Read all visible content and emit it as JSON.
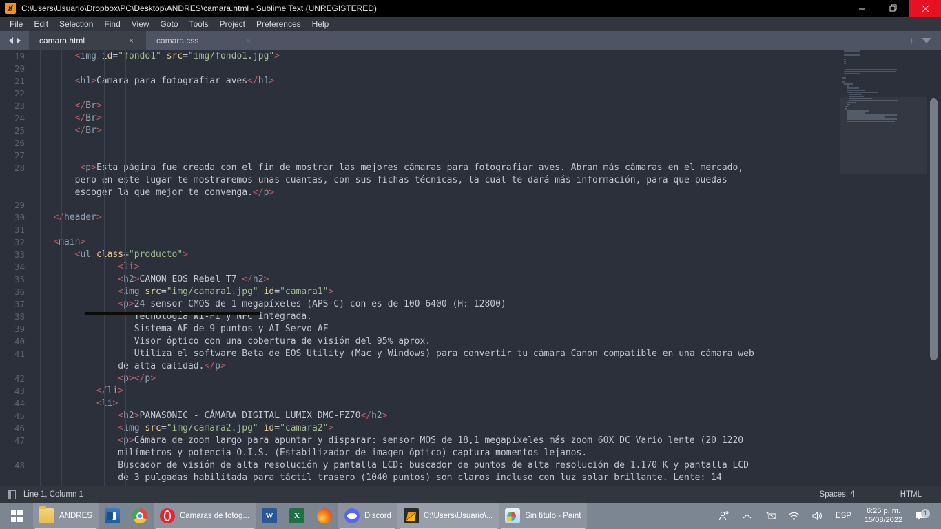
{
  "window": {
    "title": "C:\\Users\\Usuario\\Dropbox\\PC\\Desktop\\ANDRES\\camara.html - Sublime Text (UNREGISTERED)",
    "app_icon": "sublime-text-icon",
    "controls": {
      "minimize": "minimize-icon",
      "maximize": "maximize-icon",
      "close": "close-icon"
    },
    "accent_close": "#e81123"
  },
  "menubar": {
    "items": [
      {
        "label": "File"
      },
      {
        "label": "Edit"
      },
      {
        "label": "Selection"
      },
      {
        "label": "Find"
      },
      {
        "label": "View"
      },
      {
        "label": "Goto"
      },
      {
        "label": "Tools"
      },
      {
        "label": "Project"
      },
      {
        "label": "Preferences"
      },
      {
        "label": "Help"
      }
    ]
  },
  "tabbar": {
    "prev_icon": "arrow-left-icon",
    "next_icon": "arrow-right-icon",
    "tabs": [
      {
        "label": "camara.html",
        "active": true,
        "close": "×"
      },
      {
        "label": "camara.css",
        "active": false,
        "close": "×"
      }
    ],
    "new_tab": "+",
    "tab_menu": "chevron-down-icon"
  },
  "editor": {
    "first_line": 19,
    "lines": [
      {
        "n": 19,
        "tokens": [
          {
            "t": "sp",
            "v": "        "
          },
          {
            "t": "tagp",
            "v": "<"
          },
          {
            "t": "tagn",
            "v": "img "
          },
          {
            "t": "attr",
            "v": "id"
          },
          {
            "t": "eq",
            "v": "="
          },
          {
            "t": "str",
            "v": "\"fondo1\""
          },
          {
            "t": "txt",
            "v": " "
          },
          {
            "t": "attr",
            "v": "src"
          },
          {
            "t": "eq",
            "v": "="
          },
          {
            "t": "str",
            "v": "\"img/fondo1.jpg\""
          },
          {
            "t": "tagp",
            "v": ">"
          }
        ]
      },
      {
        "n": 20,
        "tokens": []
      },
      {
        "n": 21,
        "tokens": [
          {
            "t": "sp",
            "v": "        "
          },
          {
            "t": "tagp",
            "v": "<"
          },
          {
            "t": "tagn",
            "v": "h1"
          },
          {
            "t": "tagp",
            "v": ">"
          },
          {
            "t": "txt",
            "v": "Camara para fotografiar aves"
          },
          {
            "t": "tagp",
            "v": "</"
          },
          {
            "t": "tagn",
            "v": "h1"
          },
          {
            "t": "tagp",
            "v": ">"
          }
        ]
      },
      {
        "n": 22,
        "tokens": []
      },
      {
        "n": 23,
        "tokens": [
          {
            "t": "sp",
            "v": "        "
          },
          {
            "t": "tagp",
            "v": "</"
          },
          {
            "t": "tagn",
            "v": "Br"
          },
          {
            "t": "tagp",
            "v": ">"
          }
        ]
      },
      {
        "n": 24,
        "tokens": [
          {
            "t": "sp",
            "v": "        "
          },
          {
            "t": "tagp",
            "v": "</"
          },
          {
            "t": "tagn",
            "v": "Br"
          },
          {
            "t": "tagp",
            "v": ">"
          }
        ]
      },
      {
        "n": 25,
        "tokens": [
          {
            "t": "sp",
            "v": "        "
          },
          {
            "t": "tagp",
            "v": "</"
          },
          {
            "t": "tagn",
            "v": "Br"
          },
          {
            "t": "tagp",
            "v": ">"
          }
        ]
      },
      {
        "n": 26,
        "tokens": []
      },
      {
        "n": 27,
        "tokens": []
      },
      {
        "n": 28,
        "tokens": [
          {
            "t": "sp",
            "v": "         "
          },
          {
            "t": "tagp",
            "v": "<"
          },
          {
            "t": "tagn",
            "v": "p"
          },
          {
            "t": "tagp",
            "v": ">"
          },
          {
            "t": "txt",
            "v": "Esta página fue creada con el fin de mostrar las mejores cámaras para fotografiar aves. Abran más cámaras en el mercado,"
          }
        ]
      },
      {
        "n": "",
        "tokens": [
          {
            "t": "sp",
            "v": "        "
          },
          {
            "t": "txt",
            "v": "pero en este lugar te mostraremos unas cuantas, con sus fichas técnicas, la cual te dará más información, para que puedas"
          }
        ]
      },
      {
        "n": "",
        "tokens": [
          {
            "t": "sp",
            "v": "        "
          },
          {
            "t": "txt",
            "v": "escoger la que mejor te convenga."
          },
          {
            "t": "tagp",
            "v": "</"
          },
          {
            "t": "tagn",
            "v": "p"
          },
          {
            "t": "tagp",
            "v": ">"
          }
        ]
      },
      {
        "n": 29,
        "tokens": []
      },
      {
        "n": 30,
        "tokens": [
          {
            "t": "sp",
            "v": "    "
          },
          {
            "t": "tagp",
            "v": "</"
          },
          {
            "t": "tagn",
            "v": "header"
          },
          {
            "t": "tagp",
            "v": ">"
          }
        ]
      },
      {
        "n": 31,
        "tokens": []
      },
      {
        "n": 32,
        "tokens": [
          {
            "t": "sp",
            "v": "    "
          },
          {
            "t": "tagp",
            "v": "<"
          },
          {
            "t": "tagn",
            "v": "main"
          },
          {
            "t": "tagp",
            "v": ">"
          }
        ]
      },
      {
        "n": 33,
        "tokens": [
          {
            "t": "sp",
            "v": "        "
          },
          {
            "t": "tagp",
            "v": "<"
          },
          {
            "t": "tagn",
            "v": "ul "
          },
          {
            "t": "attr",
            "v": "class"
          },
          {
            "t": "eq",
            "v": "="
          },
          {
            "t": "str",
            "v": "\"producto\""
          },
          {
            "t": "tagp",
            "v": ">"
          }
        ]
      },
      {
        "n": 34,
        "tokens": [
          {
            "t": "sp",
            "v": "                "
          },
          {
            "t": "tagp",
            "v": "<"
          },
          {
            "t": "tagn",
            "v": "li"
          },
          {
            "t": "tagp",
            "v": ">"
          }
        ]
      },
      {
        "n": 35,
        "tokens": [
          {
            "t": "sp",
            "v": "                "
          },
          {
            "t": "tagp",
            "v": "<"
          },
          {
            "t": "tagn",
            "v": "h2"
          },
          {
            "t": "tagp",
            "v": ">"
          },
          {
            "t": "txt",
            "v": "CANON EOS Rebel T7 "
          },
          {
            "t": "tagp",
            "v": "</"
          },
          {
            "t": "tagn",
            "v": "h2"
          },
          {
            "t": "tagp",
            "v": ">"
          }
        ]
      },
      {
        "n": 36,
        "tokens": [
          {
            "t": "sp",
            "v": "                "
          },
          {
            "t": "tagp",
            "v": "<"
          },
          {
            "t": "tagn",
            "v": "img "
          },
          {
            "t": "attr",
            "v": "src"
          },
          {
            "t": "eq",
            "v": "="
          },
          {
            "t": "str",
            "v": "\"img/camara1.jpg\""
          },
          {
            "t": "txt",
            "v": " "
          },
          {
            "t": "attr",
            "v": "id"
          },
          {
            "t": "eq",
            "v": "="
          },
          {
            "t": "str",
            "v": "\"camara1\""
          },
          {
            "t": "tagp",
            "v": ">"
          }
        ]
      },
      {
        "n": 37,
        "tokens": [
          {
            "t": "sp",
            "v": "                "
          },
          {
            "t": "tagp",
            "v": "<"
          },
          {
            "t": "tagn",
            "v": "p"
          },
          {
            "t": "tagp",
            "v": ">"
          },
          {
            "t": "txt",
            "v": "24 sensor CMOS de 1 megapíxeles (APS-C) con es de 100-6400 (H: 12800)"
          }
        ]
      },
      {
        "n": 38,
        "tokens": [
          {
            "t": "sp",
            "v": "                   "
          },
          {
            "t": "txt",
            "v": "Tecnología Wi-Fi y NFC integrada."
          }
        ]
      },
      {
        "n": 39,
        "tokens": [
          {
            "t": "sp",
            "v": "                   "
          },
          {
            "t": "txt",
            "v": "Sistema AF de 9 puntos y AI Servo AF"
          }
        ]
      },
      {
        "n": 40,
        "tokens": [
          {
            "t": "sp",
            "v": "                   "
          },
          {
            "t": "txt",
            "v": "Visor óptico con una cobertura de visión del 95% aprox."
          }
        ]
      },
      {
        "n": 41,
        "tokens": [
          {
            "t": "sp",
            "v": "                   "
          },
          {
            "t": "txt",
            "v": "Utiliza el software Beta de EOS Utility (Mac y Windows) para convertir tu cámara Canon compatible en una cámara web"
          }
        ]
      },
      {
        "n": "",
        "tokens": [
          {
            "t": "sp",
            "v": "                "
          },
          {
            "t": "txt",
            "v": "de alta calidad."
          },
          {
            "t": "tagp",
            "v": "</"
          },
          {
            "t": "tagn",
            "v": "p"
          },
          {
            "t": "tagp",
            "v": ">"
          }
        ]
      },
      {
        "n": 42,
        "tokens": [
          {
            "t": "sp",
            "v": "                "
          },
          {
            "t": "tagp",
            "v": "<"
          },
          {
            "t": "tagn",
            "v": "p"
          },
          {
            "t": "tagp",
            "v": ">"
          },
          {
            "t": "tagp",
            "v": "</"
          },
          {
            "t": "tagn",
            "v": "p"
          },
          {
            "t": "tagp",
            "v": ">"
          }
        ]
      },
      {
        "n": 43,
        "tokens": [
          {
            "t": "sp",
            "v": "            "
          },
          {
            "t": "tagp",
            "v": "</"
          },
          {
            "t": "tagn",
            "v": "li"
          },
          {
            "t": "tagp",
            "v": ">"
          }
        ]
      },
      {
        "n": 44,
        "tokens": [
          {
            "t": "sp",
            "v": "            "
          },
          {
            "t": "tagp",
            "v": "<"
          },
          {
            "t": "tagn",
            "v": "li"
          },
          {
            "t": "tagp",
            "v": ">"
          }
        ]
      },
      {
        "n": 45,
        "tokens": [
          {
            "t": "sp",
            "v": "                "
          },
          {
            "t": "tagp",
            "v": "<"
          },
          {
            "t": "tagn",
            "v": "h2"
          },
          {
            "t": "tagp",
            "v": ">"
          },
          {
            "t": "txt",
            "v": "PANASONIC - CÁMARA DIGITAL LUMIX DMC-FZ70"
          },
          {
            "t": "tagp",
            "v": "</"
          },
          {
            "t": "tagn",
            "v": "h2"
          },
          {
            "t": "tagp",
            "v": ">"
          }
        ]
      },
      {
        "n": 46,
        "tokens": [
          {
            "t": "sp",
            "v": "                "
          },
          {
            "t": "tagp",
            "v": "<"
          },
          {
            "t": "tagn",
            "v": "img "
          },
          {
            "t": "attr",
            "v": "src"
          },
          {
            "t": "eq",
            "v": "="
          },
          {
            "t": "str",
            "v": "\"img/camara2.jpg\""
          },
          {
            "t": "txt",
            "v": " "
          },
          {
            "t": "attr",
            "v": "id"
          },
          {
            "t": "eq",
            "v": "="
          },
          {
            "t": "str",
            "v": "\"camara2\""
          },
          {
            "t": "tagp",
            "v": ">"
          }
        ]
      },
      {
        "n": 47,
        "tokens": [
          {
            "t": "sp",
            "v": "                "
          },
          {
            "t": "tagp",
            "v": "<"
          },
          {
            "t": "tagn",
            "v": "p"
          },
          {
            "t": "tagp",
            "v": ">"
          },
          {
            "t": "txt",
            "v": "Cámara de zoom largo para apuntar y disparar: sensor MOS de 18,1 megapíxeles más zoom 60X DC Vario lente (20 1220"
          }
        ]
      },
      {
        "n": "",
        "tokens": [
          {
            "t": "sp",
            "v": "                "
          },
          {
            "t": "txt",
            "v": "milímetros y potencia O.I.S. (Estabilizador de imagen óptico) captura momentos lejanos."
          }
        ]
      },
      {
        "n": 48,
        "tokens": [
          {
            "t": "sp",
            "v": "                "
          },
          {
            "t": "txt",
            "v": "Buscador de visión de alta resolución y pantalla LCD: buscador de puntos de alta resolución de 1.170 K y pantalla LCD"
          }
        ]
      },
      {
        "n": "",
        "tokens": [
          {
            "t": "sp",
            "v": "                "
          },
          {
            "t": "txt",
            "v": "de 3 pulgadas habilitada para táctil trasero (1040 puntos) son claros incluso con luz solar brillante. Lente: 14"
          }
        ]
      }
    ],
    "annotation": {
      "name": "black-marker-stroke"
    }
  },
  "statusbar": {
    "encoding_icon": "sidebar-toggle-icon",
    "cursor_position": "Line 1, Column 1",
    "indentation": "Spaces: 4",
    "syntax": "HTML"
  },
  "taskbar": {
    "start_icon": "windows-start-icon",
    "items": [
      {
        "label": "ANDRES",
        "icon": "folder-icon",
        "state": "grouped"
      },
      {
        "label": "",
        "icon": "outlook-icon",
        "state": "plain"
      },
      {
        "label": "",
        "icon": "chrome-icon",
        "state": "plain"
      },
      {
        "label": "Camaras de fotog...",
        "icon": "opera-icon",
        "state": "grouped"
      },
      {
        "label": "",
        "icon": "word-icon",
        "state": "plain"
      },
      {
        "label": "",
        "icon": "excel-icon",
        "state": "plain"
      },
      {
        "label": "",
        "icon": "firefox-icon",
        "state": "plain"
      },
      {
        "label": "Discord",
        "icon": "discord-icon",
        "state": "grouped"
      },
      {
        "label": "C:\\Users\\Usuario\\...",
        "icon": "sublime-text-icon",
        "state": "active"
      },
      {
        "label": "Sin título - Paint",
        "icon": "paint-icon",
        "state": "grouped"
      }
    ],
    "tray": {
      "people_icon": "people-icon",
      "overflow_icon": "chevron-up-icon",
      "removable_icon": "usb-eject-icon",
      "network_icon": "wifi-icon",
      "volume_icon": "speaker-icon",
      "language": "ESP",
      "time": "6:25 p. m.",
      "date": "15/08/2022",
      "notifications_icon": "action-center-icon",
      "notifications_count": "1"
    }
  }
}
